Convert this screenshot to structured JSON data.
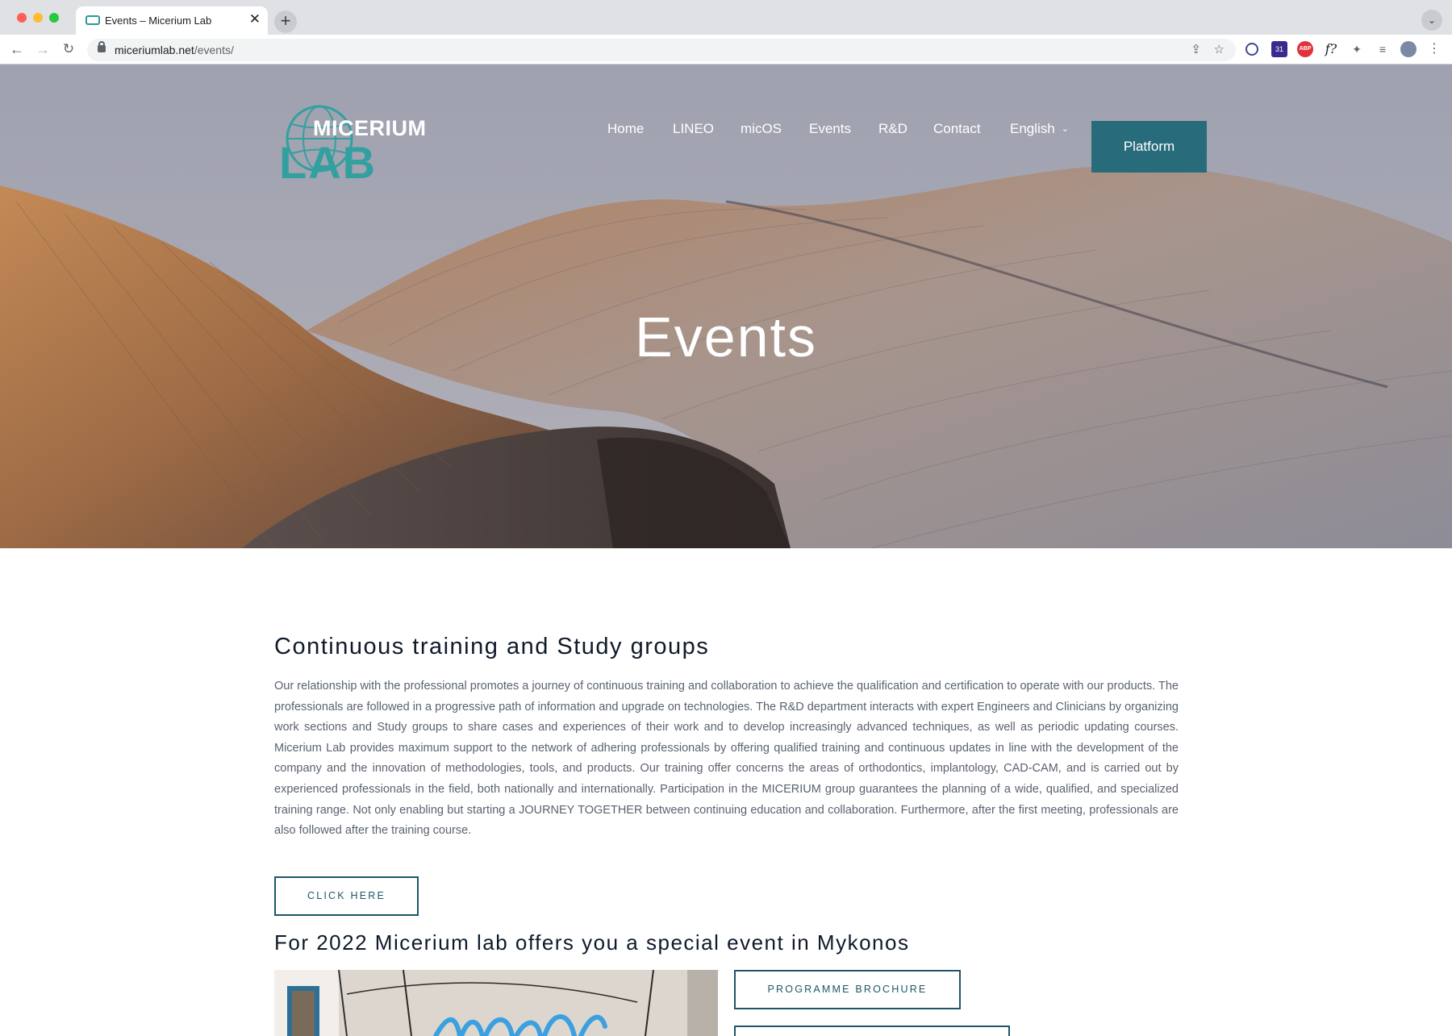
{
  "browser": {
    "tab_title": "Events – Micerium Lab",
    "tab_close": "✕",
    "new_tab": "+",
    "tab_search": "⌄",
    "url_host": "miceriumlab.net",
    "url_path": "/events/",
    "nav_back": "←",
    "nav_forward": "→",
    "nav_reload": "↻",
    "share_icon": "⇪",
    "star_icon": "☆",
    "ext_calendar_badge": "31",
    "ext_abp_label": "ABP",
    "ext_font_label": "f?",
    "ext_puzzle": "✦",
    "ext_list": "≡",
    "menu": "⋮"
  },
  "site": {
    "logo_word": "MICERIUM",
    "logo_lab": "LAB",
    "nav": {
      "home": "Home",
      "lineo": "LINEO",
      "micos": "micOS",
      "events": "Events",
      "rd": "R&D",
      "contact": "Contact",
      "language": "English",
      "language_chevron": "⌄"
    },
    "platform_button": "Platform",
    "hero_title": "Events"
  },
  "main": {
    "training_heading": "Continuous training and Study groups",
    "training_body": "Our relationship with the professional promotes a journey of continuous training and collaboration to achieve the qualification and certification to operate with our products. The professionals are followed in a progressive path of information and upgrade on technologies. The R&D department interacts with expert Engineers and Clinicians by organizing work sections and Study groups to share cases and experiences of their work and to develop increasingly advanced techniques, as well as periodic updating courses. Micerium Lab provides maximum support to the network of adhering professionals by offering qualified training and continuous updates in line with the development of the company and the innovation of methodologies, tools, and products. Our training offer concerns the areas of orthodontics, implantology, CAD-CAM, and is carried out by experienced professionals in the field, both nationally and internationally. Participation in the MICERIUM group guarantees the planning of a wide, qualified, and specialized training range. Not only enabling but starting a JOURNEY TOGETHER between continuing education and collaboration. Furthermore, after the first meeting, professionals are also followed after the training course.",
    "click_here_button": "CLICK HERE",
    "mykonos_heading": "For 2022 Micerium lab offers you a special event in Mykonos",
    "brochure_button": "PROGRAMME BROCHURE"
  },
  "colors": {
    "brand_teal": "#286b7a",
    "logo_teal": "#33a0a0",
    "button_outline": "#1f5666"
  }
}
